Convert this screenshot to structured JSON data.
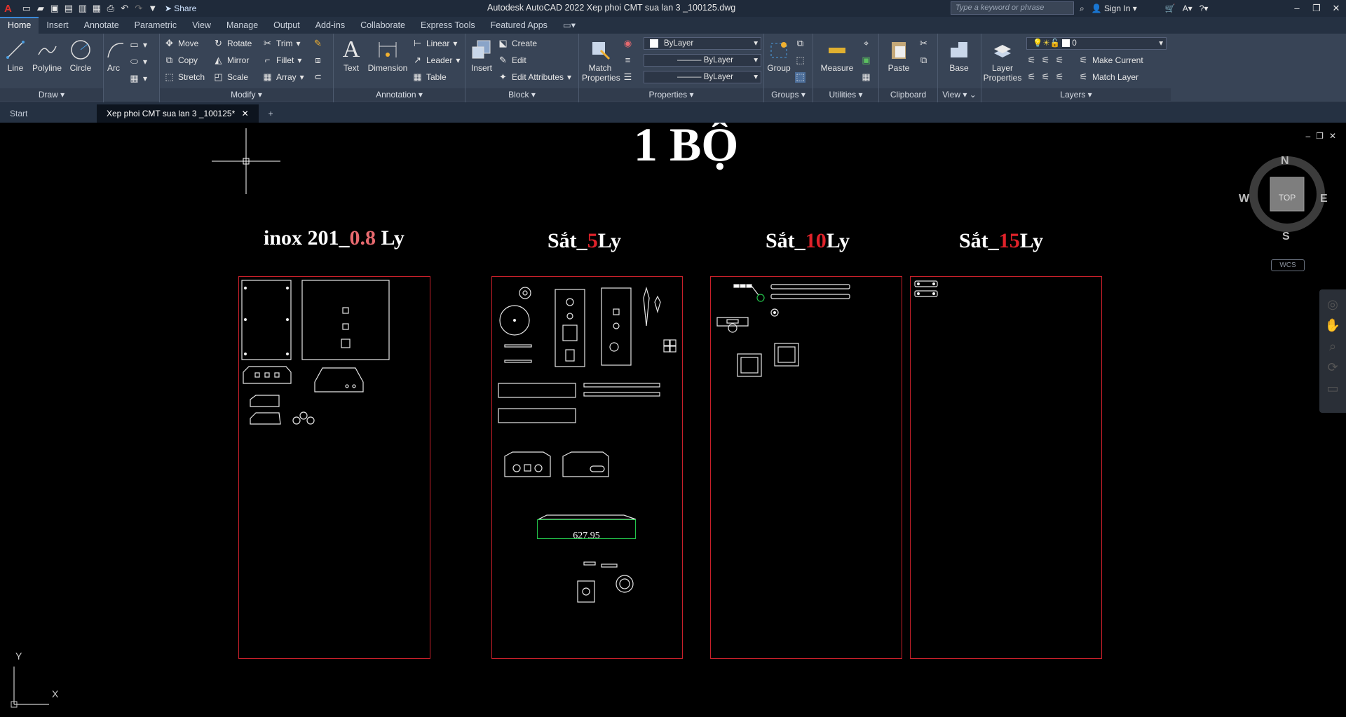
{
  "app": {
    "title": "Autodesk AutoCAD 2022   Xep phoi CMT sua lan 3 _100125.dwg",
    "share_label": "Share",
    "search_placeholder": "Type a keyword or phrase",
    "sign_in": "Sign In"
  },
  "ribbon_tabs": [
    "Home",
    "Insert",
    "Annotate",
    "Parametric",
    "View",
    "Manage",
    "Output",
    "Add-ins",
    "Collaborate",
    "Express Tools",
    "Featured Apps"
  ],
  "draw": {
    "title": "Draw",
    "line": "Line",
    "polyline": "Polyline",
    "circle": "Circle",
    "arc": "Arc"
  },
  "modify": {
    "title": "Modify",
    "move": "Move",
    "rotate": "Rotate",
    "trim": "Trim",
    "copy": "Copy",
    "mirror": "Mirror",
    "fillet": "Fillet",
    "stretch": "Stretch",
    "scale": "Scale",
    "array": "Array"
  },
  "annotation": {
    "title": "Annotation",
    "text": "Text",
    "dimension": "Dimension",
    "linear": "Linear",
    "leader": "Leader",
    "table": "Table"
  },
  "block": {
    "title": "Block",
    "insert": "Insert",
    "create": "Create",
    "edit": "Edit",
    "edit_attributes": "Edit Attributes"
  },
  "properties": {
    "title": "Properties",
    "match": "Match Properties",
    "color": "ByLayer",
    "linetype": "ByLayer",
    "lineweight": "ByLayer"
  },
  "groups": {
    "title": "Groups",
    "group": "Group"
  },
  "utilities": {
    "title": "Utilities",
    "measure": "Measure"
  },
  "clipboard": {
    "title": "Clipboard",
    "paste": "Paste"
  },
  "view": {
    "title": "View",
    "base": "Base"
  },
  "layers": {
    "title": "Layers",
    "layer_properties": "Layer Properties",
    "current_layer": "0",
    "make_current": "Make Current",
    "match_layer": "Match Layer"
  },
  "doc_tabs": {
    "start": "Start",
    "active": "Xep phoi CMT sua lan 3 _100125*"
  },
  "drawing": {
    "heading": "1 BỘ",
    "labels": [
      {
        "prefix": "inox 201_",
        "value": "0.8",
        "suffix": " Ly"
      },
      {
        "prefix": "Sắt_",
        "value": "5",
        "suffix": "Ly"
      },
      {
        "prefix": "Sắt_",
        "value": "10",
        "suffix": "Ly"
      },
      {
        "prefix": "Sắt_",
        "value": "15",
        "suffix": "Ly"
      }
    ],
    "dimension_value": "627.95"
  },
  "viewcube": {
    "n": "N",
    "s": "S",
    "e": "E",
    "w": "W",
    "face": "TOP",
    "wcs": "WCS"
  },
  "ucs": {
    "x": "X",
    "y": "Y"
  },
  "colors": {
    "accent_red": "#e0222a",
    "sheet_border": "#c8202a",
    "ribbon_bg": "#384456",
    "selected_green": "#22c24a"
  }
}
